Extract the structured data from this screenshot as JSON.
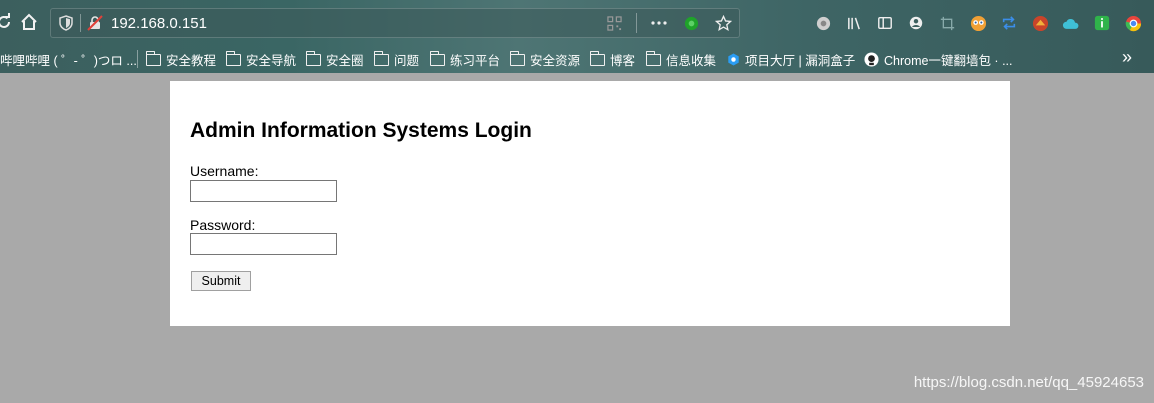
{
  "browser": {
    "url": "192.168.0.151",
    "more_glyph": "»",
    "bookmarks": [
      {
        "label": "哔哩哔哩 ( ゜- ゜)つロ ...",
        "icon": "none"
      },
      {
        "label": "安全教程",
        "icon": "folder"
      },
      {
        "label": "安全导航",
        "icon": "folder"
      },
      {
        "label": "安全圈",
        "icon": "folder"
      },
      {
        "label": "问题",
        "icon": "folder"
      },
      {
        "label": "练习平台",
        "icon": "folder"
      },
      {
        "label": "安全资源",
        "icon": "folder"
      },
      {
        "label": "博客",
        "icon": "folder"
      },
      {
        "label": "信息收集",
        "icon": "folder"
      },
      {
        "label": "项目大厅 | 漏洞盒子",
        "icon": "hexagon"
      },
      {
        "label": "Chrome一键翻墙包 · ...",
        "icon": "github"
      }
    ]
  },
  "login": {
    "title": "Admin Information Systems Login",
    "username_label": "Username:",
    "username_value": "",
    "password_label": "Password:",
    "password_value": "",
    "submit_label": "Submit"
  },
  "watermark": "https://blog.csdn.net/qq_45924653"
}
